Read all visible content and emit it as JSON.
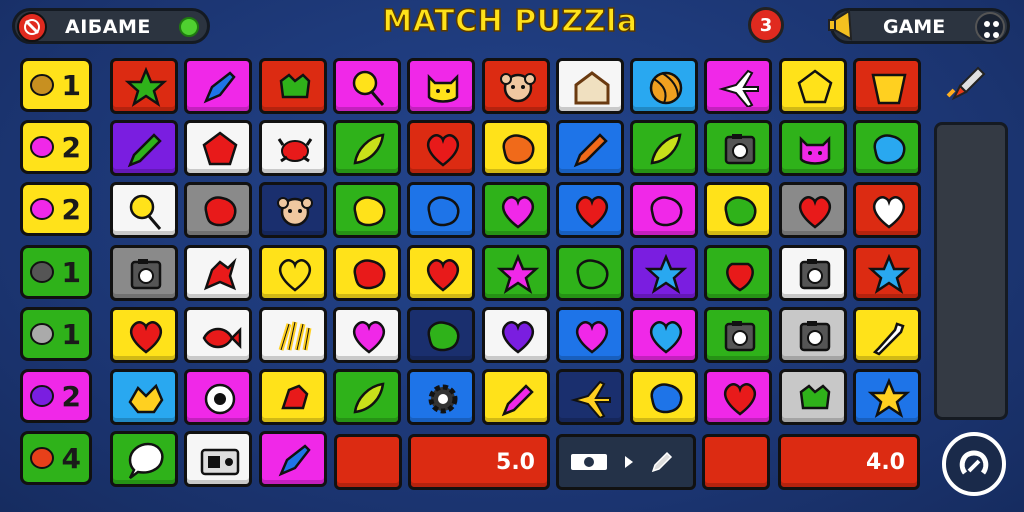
{
  "colors": {
    "red": "#dc2b12",
    "magenta": "#f028e8",
    "yellow": "#ffe21a",
    "blue": "#1e74e8",
    "green": "#2fb21a",
    "purple": "#7a1ee0",
    "white": "#f6f6f6",
    "gray": "#8a8a8a",
    "cyan": "#29a8f0",
    "navy": "#1a2f6e",
    "lightgray": "#c8c8c8"
  },
  "header": {
    "player_name": "AIБAME",
    "title": "MATCH PUZZla",
    "help_label": "3",
    "game_label": "GAME"
  },
  "scores": [
    {
      "icon": "cookie-icon",
      "value": "1",
      "bg": "#ffe21a"
    },
    {
      "icon": "pig-icon",
      "value": "2",
      "bg": "#ffe21a"
    },
    {
      "icon": "blob-icon",
      "value": "2",
      "bg": "#ffe21a"
    },
    {
      "icon": "camera-icon",
      "value": "1",
      "bg": "#2fb21a"
    },
    {
      "icon": "cat-icon",
      "value": "1",
      "bg": "#2fb21a"
    },
    {
      "icon": "heart-icon",
      "value": "2",
      "bg": "#f028e8"
    },
    {
      "icon": "bug-icon",
      "value": "4",
      "bg": "#2fb21a"
    }
  ],
  "grid": [
    [
      {
        "bg": "red",
        "icon": "star"
      },
      {
        "bg": "magenta",
        "icon": "rocket"
      },
      {
        "bg": "red",
        "icon": "frog"
      },
      {
        "bg": "magenta",
        "icon": "lollipop"
      },
      {
        "bg": "magenta",
        "icon": "cat"
      },
      {
        "bg": "red",
        "icon": "monkey"
      },
      {
        "bg": "white",
        "icon": "house"
      },
      {
        "bg": "cyan",
        "icon": "ball"
      },
      {
        "bg": "magenta",
        "icon": "plane"
      },
      {
        "bg": "yellow",
        "icon": "pentagon"
      },
      {
        "bg": "red",
        "icon": "cup"
      }
    ],
    [
      {
        "bg": "purple",
        "icon": "pencil"
      },
      {
        "bg": "white",
        "icon": "pentagon"
      },
      {
        "bg": "white",
        "icon": "crab"
      },
      {
        "bg": "green",
        "icon": "leaf"
      },
      {
        "bg": "red",
        "icon": "heart"
      },
      {
        "bg": "yellow",
        "icon": "blob"
      },
      {
        "bg": "blue",
        "icon": "pencil"
      },
      {
        "bg": "green",
        "icon": "leaf"
      },
      {
        "bg": "green",
        "icon": "camera"
      },
      {
        "bg": "green",
        "icon": "cat"
      },
      {
        "bg": "green",
        "icon": "blob"
      }
    ],
    [
      {
        "bg": "white",
        "icon": "lollipop"
      },
      {
        "bg": "gray",
        "icon": "blob"
      },
      {
        "bg": "navy",
        "icon": "monkey"
      },
      {
        "bg": "green",
        "icon": "blob"
      },
      {
        "bg": "blue",
        "icon": "blob"
      },
      {
        "bg": "green",
        "icon": "heart"
      },
      {
        "bg": "blue",
        "icon": "heart"
      },
      {
        "bg": "magenta",
        "icon": "blob"
      },
      {
        "bg": "yellow",
        "icon": "blob"
      },
      {
        "bg": "gray",
        "icon": "heart"
      },
      {
        "bg": "red",
        "icon": "heart"
      }
    ],
    [
      {
        "bg": "gray",
        "icon": "camera"
      },
      {
        "bg": "white",
        "icon": "dragon"
      },
      {
        "bg": "yellow",
        "icon": "heart"
      },
      {
        "bg": "yellow",
        "icon": "blob"
      },
      {
        "bg": "yellow",
        "icon": "heart"
      },
      {
        "bg": "green",
        "icon": "star"
      },
      {
        "bg": "green",
        "icon": "blob"
      },
      {
        "bg": "purple",
        "icon": "star"
      },
      {
        "bg": "green",
        "icon": "strawberry"
      },
      {
        "bg": "white",
        "icon": "camera"
      },
      {
        "bg": "red",
        "icon": "star"
      }
    ],
    [
      {
        "bg": "yellow",
        "icon": "heart"
      },
      {
        "bg": "white",
        "icon": "fish"
      },
      {
        "bg": "white",
        "icon": "fries"
      },
      {
        "bg": "white",
        "icon": "heart"
      },
      {
        "bg": "navy",
        "icon": "blob"
      },
      {
        "bg": "white",
        "icon": "heart"
      },
      {
        "bg": "blue",
        "icon": "heart"
      },
      {
        "bg": "magenta",
        "icon": "heart"
      },
      {
        "bg": "green",
        "icon": "camera"
      },
      {
        "bg": "lightgray",
        "icon": "camera"
      },
      {
        "bg": "yellow",
        "icon": "bottle"
      }
    ],
    [
      {
        "bg": "cyan",
        "icon": "bird"
      },
      {
        "bg": "magenta",
        "icon": "eye"
      },
      {
        "bg": "yellow",
        "icon": "bug"
      },
      {
        "bg": "green",
        "icon": "leaf"
      },
      {
        "bg": "blue",
        "icon": "gear"
      },
      {
        "bg": "yellow",
        "icon": "crayon"
      },
      {
        "bg": "navy",
        "icon": "plane"
      },
      {
        "bg": "yellow",
        "icon": "blob"
      },
      {
        "bg": "magenta",
        "icon": "heart"
      },
      {
        "bg": "lightgray",
        "icon": "frog"
      },
      {
        "bg": "blue",
        "icon": "star"
      }
    ],
    [
      {
        "bg": "green",
        "icon": "bubble"
      },
      {
        "bg": "white",
        "icon": "radio"
      },
      {
        "bg": "magenta",
        "icon": "rocket"
      }
    ]
  ],
  "bottom_row": {
    "slot_label_1": "5.0",
    "slot_label_2": "4.0",
    "tools": [
      "camera-icon",
      "play-icon",
      "pencil-icon"
    ]
  },
  "progress": {
    "level": 0
  }
}
